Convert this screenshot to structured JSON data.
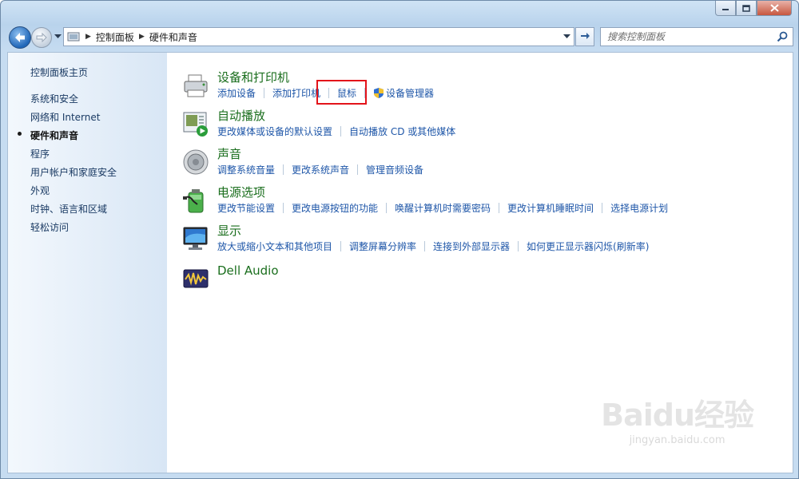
{
  "window": {
    "caption": {
      "minimize": "minimize",
      "maximize": "maximize",
      "close": "close"
    }
  },
  "nav": {
    "breadcrumb": [
      "控制面板",
      "硬件和声音"
    ],
    "search_placeholder": "搜索控制面板"
  },
  "sidebar": {
    "items": [
      {
        "label": "控制面板主页",
        "active": false
      },
      {
        "label": "系统和安全",
        "active": false
      },
      {
        "label": "网络和 Internet",
        "active": false
      },
      {
        "label": "硬件和声音",
        "active": true
      },
      {
        "label": "程序",
        "active": false
      },
      {
        "label": "用户帐户和家庭安全",
        "active": false
      },
      {
        "label": "外观",
        "active": false
      },
      {
        "label": "时钟、语言和区域",
        "active": false
      },
      {
        "label": "轻松访问",
        "active": false
      }
    ]
  },
  "categories": [
    {
      "title": "设备和打印机",
      "icon": "printer-icon",
      "links": [
        "添加设备",
        "添加打印机",
        "鼠标",
        "设备管理器"
      ]
    },
    {
      "title": "自动播放",
      "icon": "autoplay-icon",
      "links": [
        "更改媒体或设备的默认设置",
        "自动播放 CD 或其他媒体"
      ]
    },
    {
      "title": "声音",
      "icon": "speaker-icon",
      "links": [
        "调整系统音量",
        "更改系统声音",
        "管理音频设备"
      ]
    },
    {
      "title": "电源选项",
      "icon": "battery-icon",
      "links": [
        "更改节能设置",
        "更改电源按钮的功能",
        "唤醒计算机时需要密码",
        "更改计算机睡眠时间",
        "选择电源计划"
      ]
    },
    {
      "title": "显示",
      "icon": "monitor-icon",
      "links": [
        "放大或缩小文本和其他项目",
        "调整屏幕分辨率",
        "连接到外部显示器",
        "如何更正显示器闪烁(刷新率)"
      ]
    },
    {
      "title": "Dell Audio",
      "icon": "dell-audio-icon",
      "links": []
    }
  ],
  "watermark": {
    "brand": "Baidu经验",
    "url": "jingyan.baidu.com"
  },
  "colors": {
    "category_title": "#1a6e1d",
    "link": "#1e56a8",
    "highlight": "#e3131a"
  }
}
